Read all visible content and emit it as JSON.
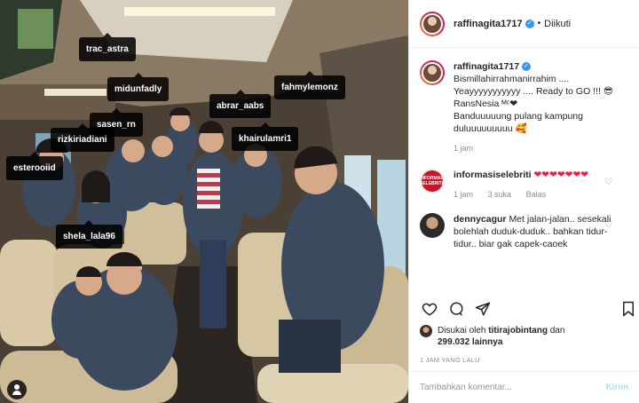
{
  "post": {
    "username": "raffinagita1717",
    "follow_status": "Diikuti",
    "dot": "•",
    "verified_mark": "✓",
    "caption_lines": [
      "Bismillahirrahmanirrahim ....",
      "Yeayyyyyyyyyyy .... Ready to GO !!! 😎",
      "RansNesia ᴹᶜ❤",
      "Banduuuuung pulang kampung",
      "duluuuuuuuuu 🥰"
    ],
    "caption_time": "1 jam"
  },
  "photo": {
    "tags": [
      {
        "name": "trac_astra"
      },
      {
        "name": "midunfadly"
      },
      {
        "name": "fahmylemonz"
      },
      {
        "name": "abrar_aabs"
      },
      {
        "name": "sasen_rn"
      },
      {
        "name": "rizkiriadiani"
      },
      {
        "name": "khairulamri1"
      },
      {
        "name": "esterooiid"
      },
      {
        "name": "shela_lala96"
      }
    ]
  },
  "comments": [
    {
      "username": "informasiselebriti",
      "text": "❤❤❤❤❤❤❤",
      "time": "1 jam",
      "likes": "3 suka",
      "reply": "Balas",
      "avatar_text": "INFORMASI SELEBRITI"
    },
    {
      "username": "dennycagur",
      "text": "Met jalan-jalan.. sesekali bolehlah duduk-duduk.. bahkan tidur-tidur.. biar gak capek-caoek"
    }
  ],
  "actions": {
    "liked_by_prefix": "Disukai oleh",
    "liked_by_user": "titirajobintang",
    "liked_by_joiner": "dan",
    "others_count": "299.032 lainnya",
    "timestamp": "1 JAM YANG LALU"
  },
  "comment_input": {
    "placeholder": "Tambahkan komentar...",
    "post_label": "Kirim"
  },
  "colors": {
    "verified": "#3897f0",
    "heart": "#ed1c43",
    "post_button": "#b2dffc"
  }
}
